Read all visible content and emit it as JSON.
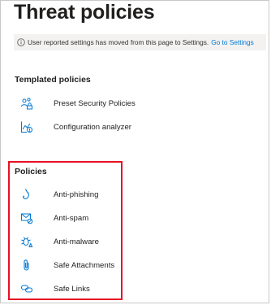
{
  "page": {
    "title": "Threat policies"
  },
  "info_bar": {
    "icon": "info-icon",
    "message": "User reported settings has moved from this page to Settings.",
    "link": "Go to Settings"
  },
  "templated": {
    "heading": "Templated policies",
    "items": [
      {
        "label": "Preset Security Policies",
        "icon": "preset-security-icon"
      },
      {
        "label": "Configuration analyzer",
        "icon": "configuration-analyzer-icon"
      }
    ]
  },
  "policies": {
    "heading": "Policies",
    "items": [
      {
        "label": "Anti-phishing",
        "icon": "fishhook-icon"
      },
      {
        "label": "Anti-spam",
        "icon": "mail-blocked-icon"
      },
      {
        "label": "Anti-malware",
        "icon": "bug-icon"
      },
      {
        "label": "Safe Attachments",
        "icon": "paperclip-icon"
      },
      {
        "label": "Safe Links",
        "icon": "link-icon"
      }
    ]
  },
  "colors": {
    "accent": "#0078d4",
    "highlight_border": "#e81123",
    "info_bar_bg": "#f3f2f1"
  }
}
